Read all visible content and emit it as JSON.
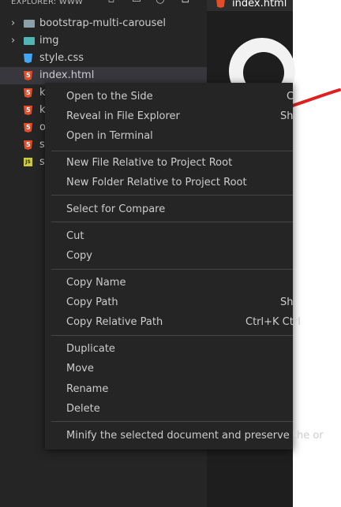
{
  "explorer": {
    "title": "EXPLORER: WWW",
    "actions": [
      "new-file-icon",
      "new-folder-icon",
      "refresh-icon",
      "collapse-all-icon"
    ]
  },
  "tree": [
    {
      "label": "bootstrap-multi-carousel",
      "type": "folder",
      "icon": "folder-icon"
    },
    {
      "label": "img",
      "type": "folder",
      "icon": "image-folder-icon"
    },
    {
      "label": "style.css",
      "type": "css",
      "icon": "css-file-icon"
    },
    {
      "label": "index.html",
      "type": "html",
      "icon": "html-file-icon",
      "selected": true
    },
    {
      "label": "k",
      "type": "html",
      "icon": "html-file-icon"
    },
    {
      "label": "k",
      "type": "html",
      "icon": "html-file-icon"
    },
    {
      "label": "o",
      "type": "html",
      "icon": "html-file-icon"
    },
    {
      "label": "sp",
      "type": "html",
      "icon": "html-file-icon"
    },
    {
      "label": "sc",
      "type": "js",
      "icon": "js-file-icon"
    }
  ],
  "editor": {
    "tab_label": "index.html"
  },
  "context_menu": {
    "items": [
      {
        "label": "Open to the Side",
        "shortcut": "C"
      },
      {
        "label": "Reveal in File Explorer",
        "shortcut": "Shi"
      },
      {
        "label": "Open in Terminal",
        "shortcut": ""
      },
      {
        "label": "New File Relative to Project Root",
        "shortcut": ""
      },
      {
        "label": "New Folder Relative to Project Root",
        "shortcut": ""
      },
      {
        "label": "Select for Compare",
        "shortcut": ""
      },
      {
        "label": "Cut",
        "shortcut": ""
      },
      {
        "label": "Copy",
        "shortcut": ""
      },
      {
        "label": "Copy Name",
        "shortcut": ""
      },
      {
        "label": "Copy Path",
        "shortcut": "Shi"
      },
      {
        "label": "Copy Relative Path",
        "shortcut": "Ctrl+K Ctrl"
      },
      {
        "label": "Duplicate",
        "shortcut": ""
      },
      {
        "label": "Move",
        "shortcut": ""
      },
      {
        "label": "Rename",
        "shortcut": ""
      },
      {
        "label": "Delete",
        "shortcut": ""
      },
      {
        "label": "Minify the selected document and preserve the or",
        "shortcut": ""
      }
    ]
  },
  "colors": {
    "sidebar_bg": "#252526",
    "editor_bg": "#1e1e1e",
    "menu_bg": "#252526",
    "annotation_red": "#e02020",
    "html_icon": "#e44d26",
    "css_icon": "#42a5f5",
    "js_icon": "#cbcb41"
  }
}
